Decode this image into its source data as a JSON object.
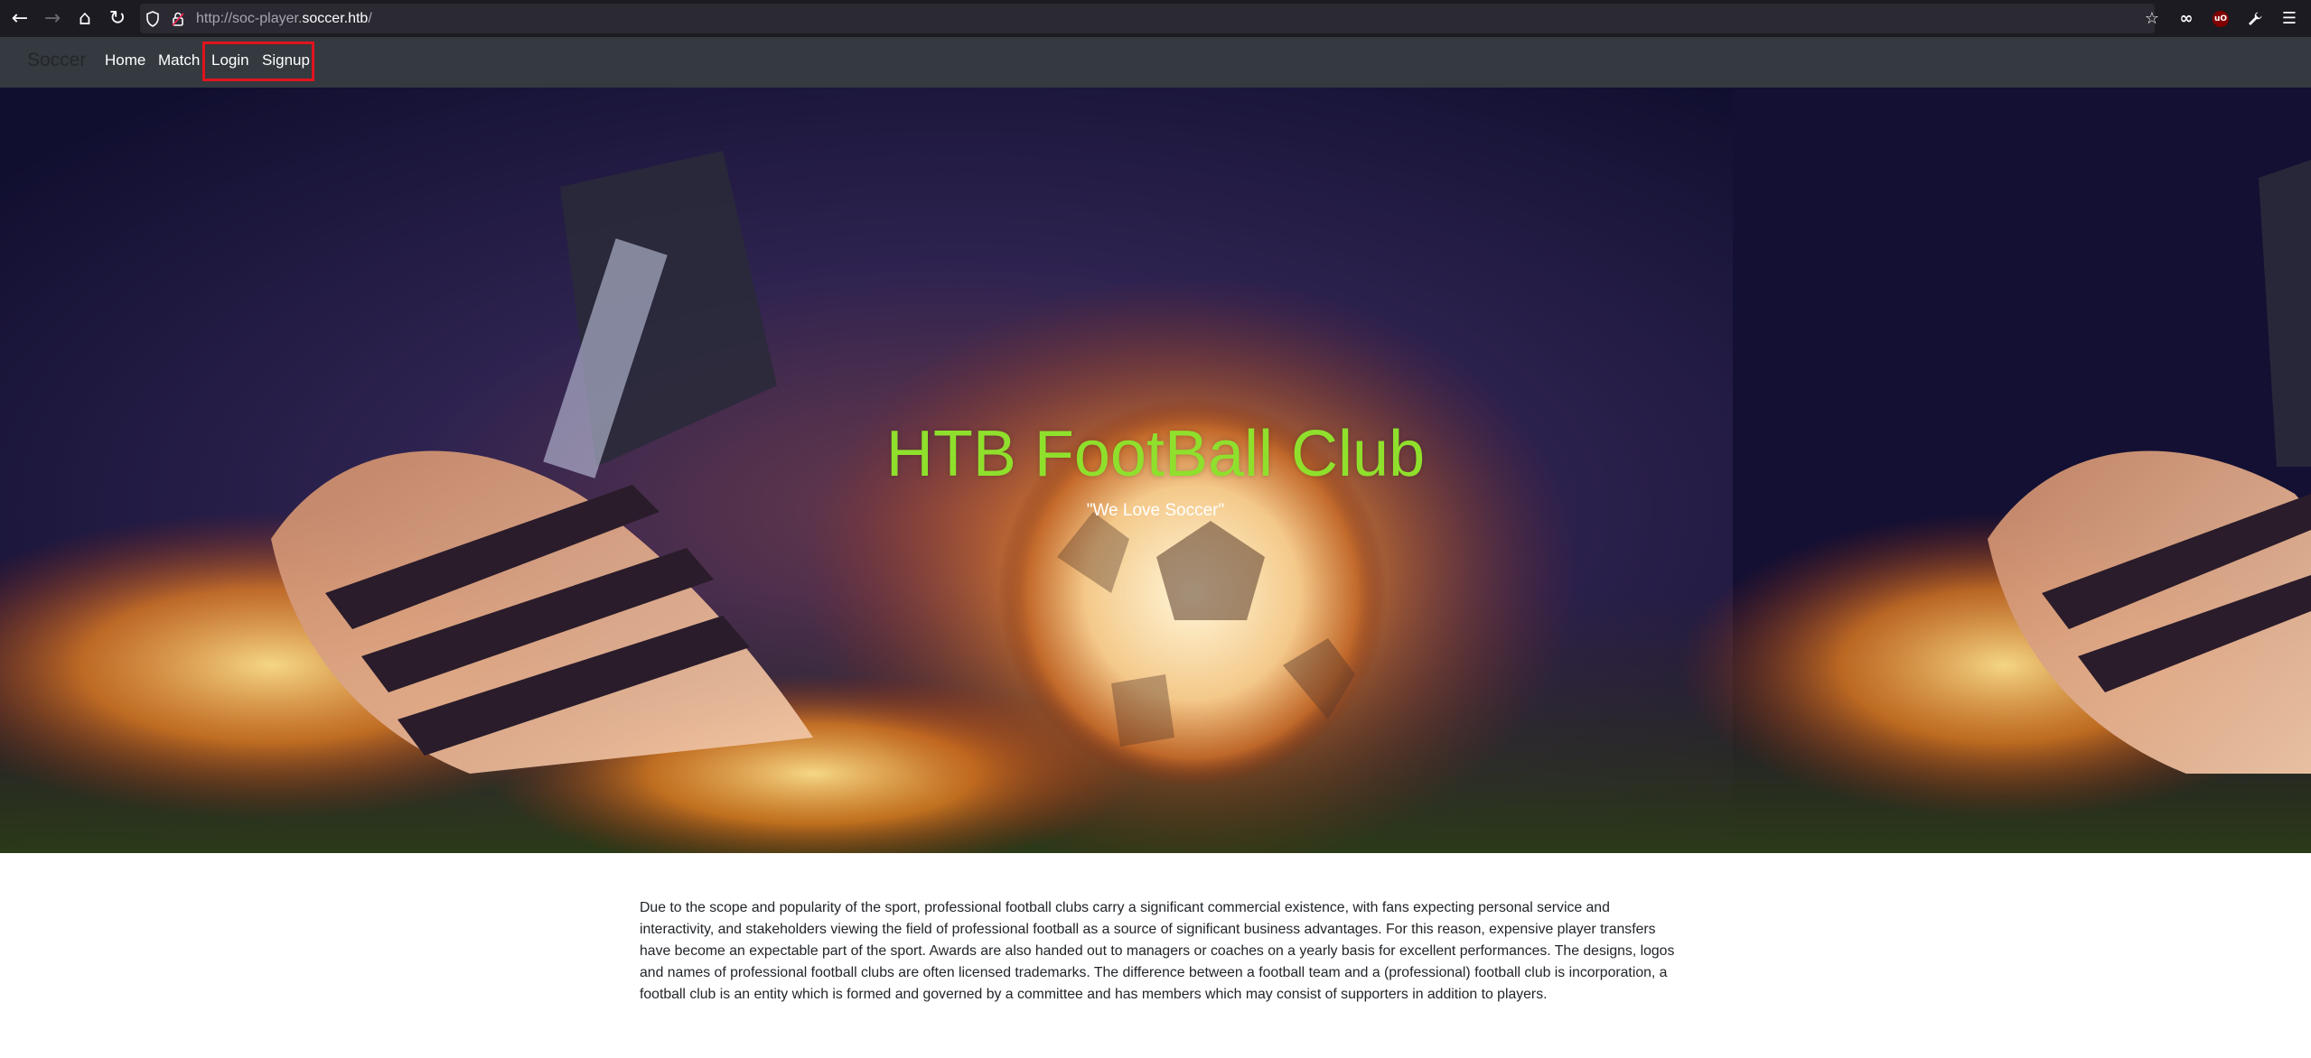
{
  "browser": {
    "url_scheme": "http://soc-player.",
    "url_host": "soccer.htb",
    "url_path": "/"
  },
  "navbar": {
    "brand": "Soccer",
    "links": [
      "Home",
      "Match",
      "Login",
      "Signup"
    ]
  },
  "hero": {
    "title": "HTB FootBall Club",
    "subtitle": "\"We Love Soccer\""
  },
  "content": {
    "paragraph": "Due to the scope and popularity of the sport, professional football clubs carry a significant commercial existence, with fans expecting personal service and interactivity, and stakeholders viewing the field of professional football as a source of significant business advantages. For this reason, expensive player transfers have become an expectable part of the sport. Awards are also handed out to managers or coaches on a yearly basis for excellent performances. The designs, logos and names of professional football clubs are often licensed trademarks. The difference between a football team and a (professional) football club is incorporation, a football club is an entity which is formed and governed by a committee and has members which may consist of supporters in addition to players."
  },
  "colors": {
    "title_accent": "#8fe02c",
    "navbar_bg": "#343a40",
    "highlight": "#e0141e"
  }
}
